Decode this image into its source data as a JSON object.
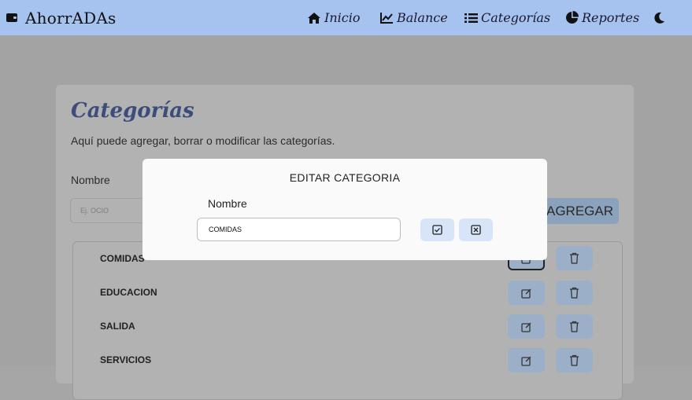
{
  "app": {
    "brand": "AhorrADAs",
    "brand_icon": "wallet-icon"
  },
  "nav": {
    "items": [
      {
        "label": "Inicio",
        "icon": "home-icon"
      },
      {
        "label": "Balance",
        "icon": "chart-line-icon"
      },
      {
        "label": "Categorías",
        "icon": "list-icon"
      },
      {
        "label": "Reportes",
        "icon": "pie-chart-icon"
      }
    ],
    "theme_icon": "moon-icon"
  },
  "page": {
    "title": "Categorías",
    "description": "Aquí puede agregar, borrar o modificar las categorías.",
    "form": {
      "label": "Nombre",
      "placeholder": "Ej. OCIO",
      "add_button": "AGREGAR"
    },
    "categories": [
      "COMIDAS",
      "EDUCACION",
      "SALIDA",
      "SERVICIOS"
    ]
  },
  "modal": {
    "title": "EDITAR CATEGORIA",
    "label": "Nombre",
    "value": "COMIDAS",
    "confirm_icon": "check-square-icon",
    "cancel_icon": "x-square-icon"
  },
  "colors": {
    "navbar": "#a6c2ef",
    "accent_title": "#3c4d7a",
    "button": "#d8e4f7"
  }
}
